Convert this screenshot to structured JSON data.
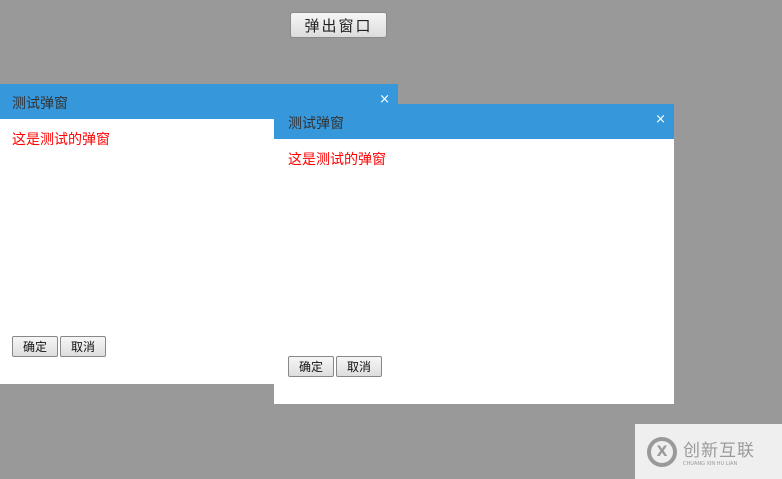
{
  "open_button": "弹出窗口",
  "dialogs": [
    {
      "title": "测试弹窗",
      "close": "×",
      "content": "这是测试的弹窗",
      "ok": "确定",
      "cancel": "取消"
    },
    {
      "title": "测试弹窗",
      "close": "×",
      "content": "这是测试的弹窗",
      "ok": "确定",
      "cancel": "取消"
    }
  ],
  "watermark": {
    "name": "创新互联",
    "subtitle": "CHUANG XIN HU LIAN",
    "logo_letter": "X"
  }
}
